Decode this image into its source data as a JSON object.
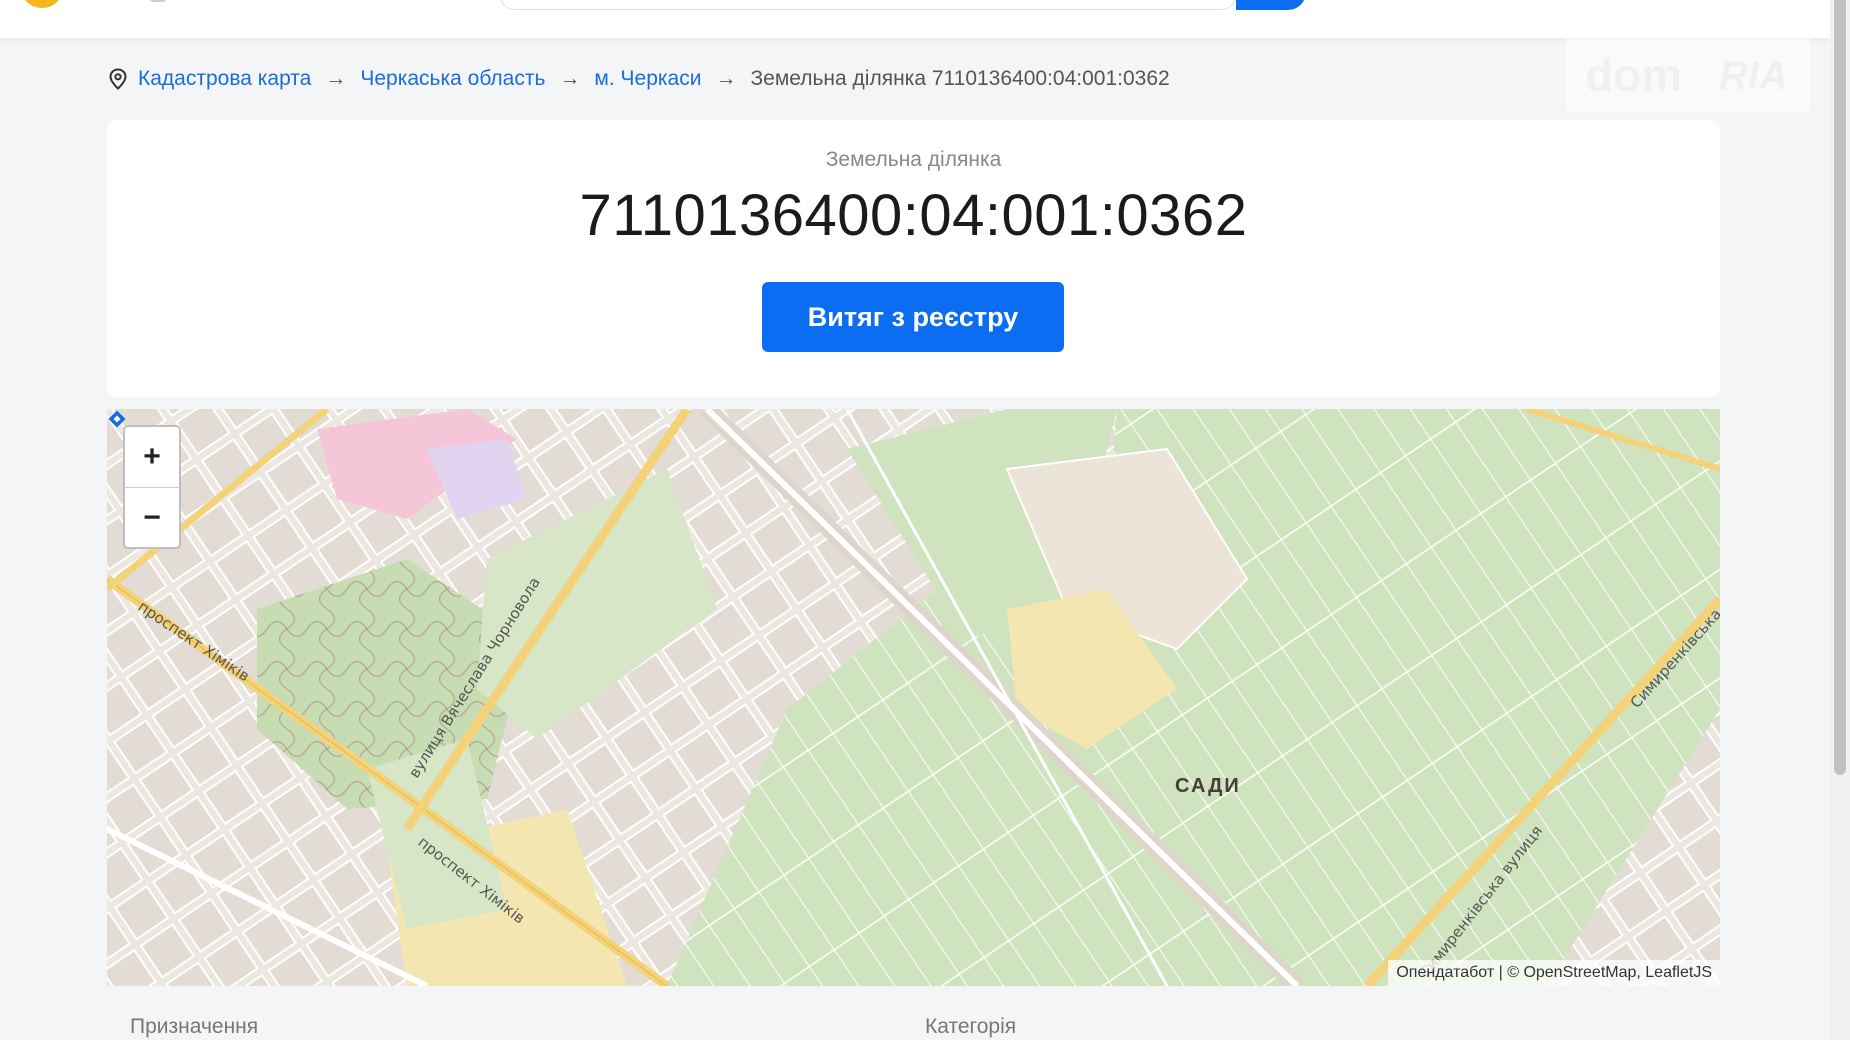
{
  "breadcrumb": {
    "items": [
      "Кадастрова карта",
      "Черкаська область",
      "м. Черкаси"
    ],
    "separator": "→",
    "current": "Земельна ділянка 7110136400:04:001:0362"
  },
  "parcel": {
    "label": "Земельна ділянка",
    "cadastral_number": "7110136400:04:001:0362",
    "extract_button": "Витяг з реєстру"
  },
  "map": {
    "zoom_in": "+",
    "zoom_out": "−",
    "attribution": "Опендатабот | © OpenStreetMap, LeafletJS",
    "poi": "САДИ",
    "streets": {
      "khimikiv_1": "проспект Хіміків",
      "khimikiv_2": "проспект Хіміків",
      "chornovola": "вулиця Вячеслава Чорновола",
      "symyrenkivska_1": "Симиренківська",
      "symyrenkivska_2": "Симиренківська вулиця"
    }
  },
  "fields": {
    "purpose_label": "Призначення",
    "category_label": "Категорія"
  },
  "colors": {
    "accent": "#0b6ef2",
    "link": "#1a6cdd",
    "map_green": "#cfe3bf",
    "map_road_yellow": "#f4d27a"
  }
}
